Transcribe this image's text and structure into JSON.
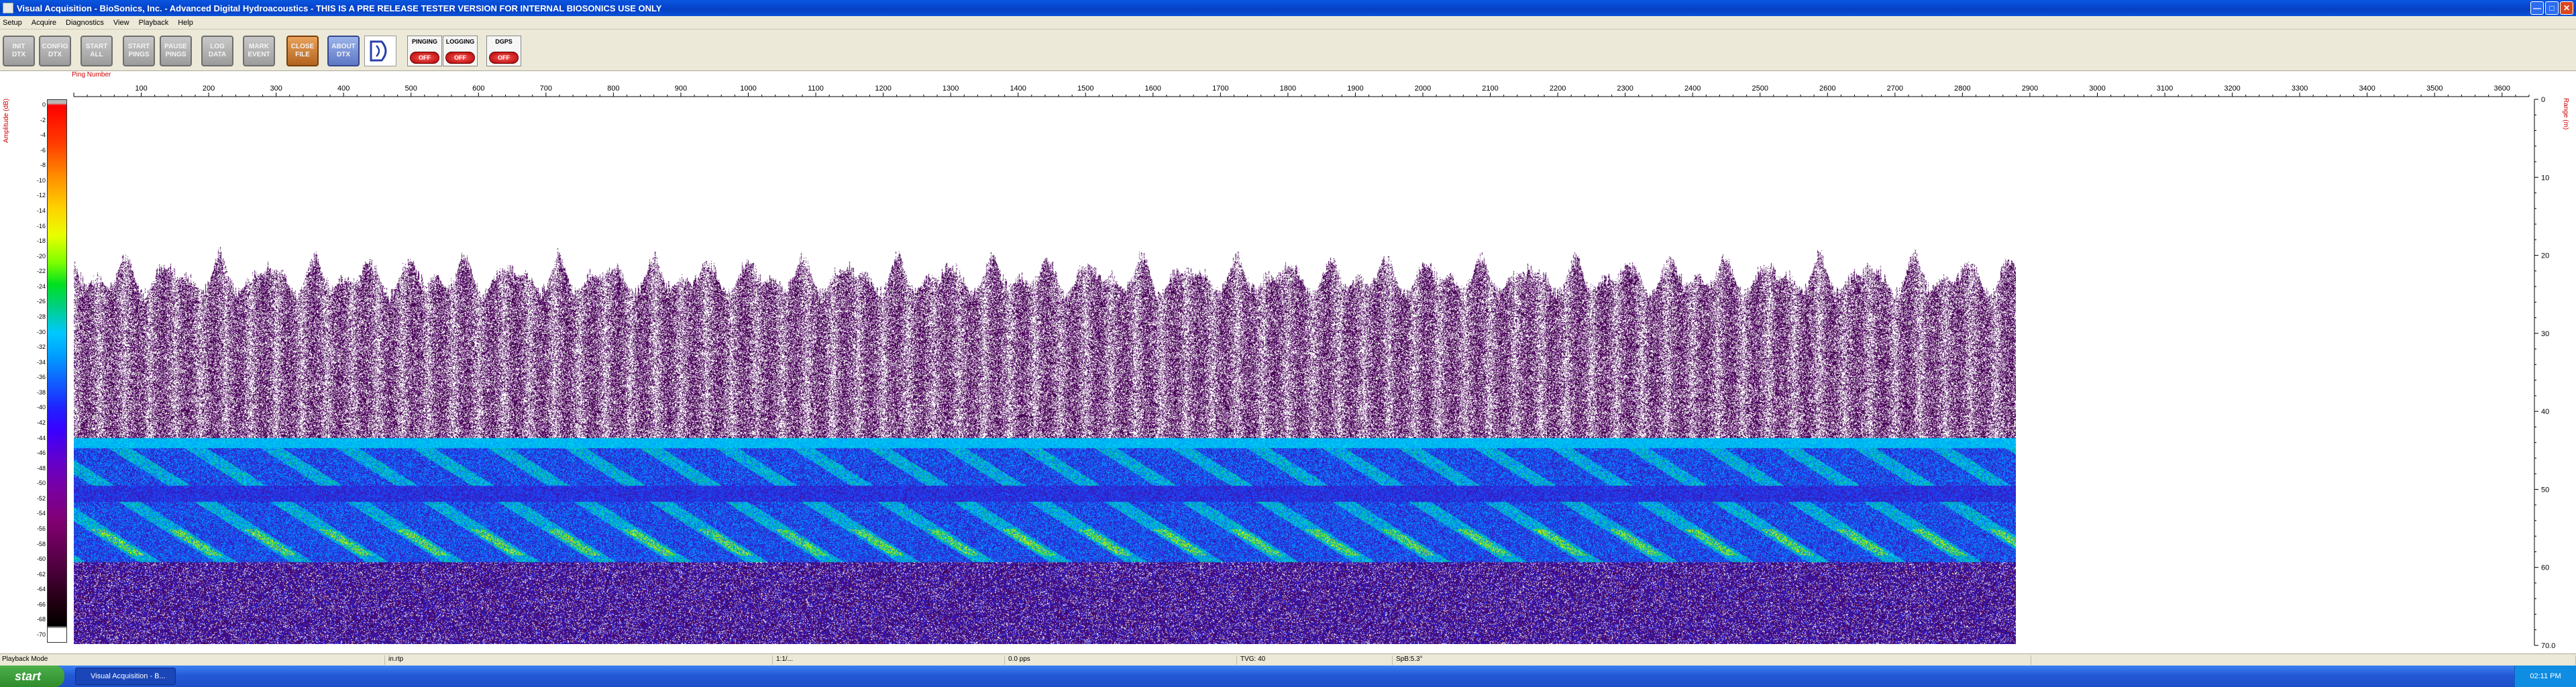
{
  "window": {
    "title": "Visual Acquisition  -  BioSonics, Inc.  -  Advanced Digital Hydroacoustics  -  THIS IS A PRE RELEASE TESTER VERSION FOR INTERNAL BIOSONICS USE ONLY"
  },
  "menu": [
    "Setup",
    "Acquire",
    "Diagnostics",
    "View",
    "Playback",
    "Help"
  ],
  "toolbar": {
    "buttons": [
      {
        "line1": "INIT",
        "line2": "DTX"
      },
      {
        "line1": "CONFIG",
        "line2": "DTX"
      },
      {
        "line1": "START",
        "line2": "ALL"
      },
      {
        "line1": "START",
        "line2": "PINGS"
      },
      {
        "line1": "PAUSE",
        "line2": "PINGS"
      },
      {
        "line1": "LOG",
        "line2": "DATA"
      },
      {
        "line1": "MARK",
        "line2": "EVENT"
      },
      {
        "line1": "CLOSE",
        "line2": "FILE"
      },
      {
        "line1": "ABOUT",
        "line2": "DTX"
      }
    ],
    "status": [
      {
        "label": "PINGING",
        "state": "OFF"
      },
      {
        "label": "LOGGING",
        "state": "OFF"
      },
      {
        "label": "DGPS",
        "state": "OFF"
      }
    ]
  },
  "plot": {
    "x_axis_label": "Ping Number",
    "left_axis_label": "Amplitude (dB)",
    "right_axis_label": "Range (m)",
    "x_ticks": [
      100,
      200,
      300,
      400,
      500,
      600,
      700,
      800,
      900,
      1000,
      1100,
      1200,
      1300,
      1400,
      1500,
      1600,
      1700,
      1800,
      1900,
      2000,
      2100,
      2200,
      2300,
      2400,
      2500,
      2600,
      2700,
      2800,
      2900,
      3000,
      3100,
      3200,
      3300,
      3400,
      3500,
      3600
    ],
    "x_range": [
      0,
      3640
    ],
    "range_ticks": [
      "0",
      "10",
      "20",
      "30",
      "40",
      "50",
      "60",
      "70.0"
    ],
    "range_max": 70,
    "colorbar_ticks": [
      "0",
      "-2",
      "-4",
      "-6",
      "-8",
      "-10",
      "-12",
      "-14",
      "-16",
      "-18",
      "-20",
      "-22",
      "-24",
      "-26",
      "-28",
      "-30",
      "-32",
      "-34",
      "-36",
      "-38",
      "-40",
      "-42",
      "-44",
      "-46",
      "-48",
      "-50",
      "-52",
      "-54",
      "-56",
      "-58",
      "-60",
      "-62",
      "-64",
      "-66",
      "-68",
      "-70"
    ],
    "data_last_ping": 2900
  },
  "statusbar": {
    "mode": "Playback Mode",
    "file": "in.rtp",
    "position": "1:1/...",
    "rate": "0.0 pps",
    "tvg": "TVG: 40",
    "sp": "SpB:5.3°"
  },
  "taskbar": {
    "start": "start",
    "task": "Visual Acquisition - B...",
    "clock": "02:11 PM"
  },
  "colors": {
    "accent": "#0a56e0",
    "axis_red": "#cc0000"
  }
}
